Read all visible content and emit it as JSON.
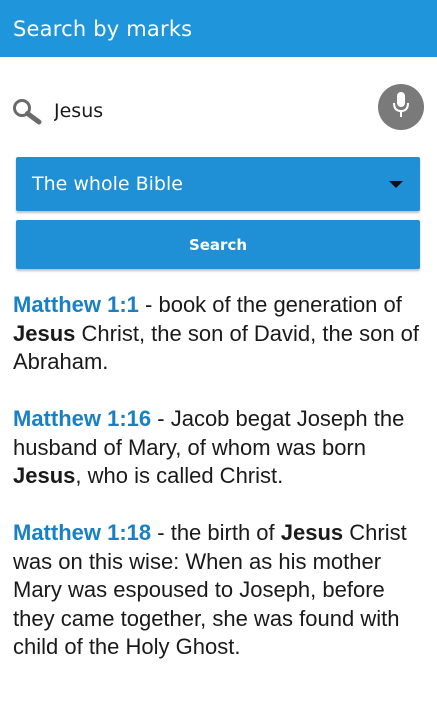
{
  "appbar": {
    "title": "Search by marks"
  },
  "search": {
    "query": "Jesus",
    "icon": "search-icon",
    "mic_icon": "microphone-icon"
  },
  "scope": {
    "selected": "The whole Bible"
  },
  "search_button": {
    "label": "Search"
  },
  "colors": {
    "accent": "#1f95dc",
    "reference": "#1a80c4",
    "mic_bg": "#7a7a7a"
  },
  "results": [
    {
      "reference": "Matthew 1:1",
      "before": " - book of the generation of ",
      "highlight": "Jesus",
      "after": " Christ, the son of David, the son of Abraham."
    },
    {
      "reference": "Matthew 1:16",
      "before": " - Jacob begat Joseph the husband of Mary, of whom was born ",
      "highlight": "Jesus",
      "after": ", who is called Christ."
    },
    {
      "reference": "Matthew 1:18",
      "before": " - the birth of ",
      "highlight": "Jesus",
      "after": " Christ was on this wise: When as his mother Mary was espoused to Joseph, before they came together, she was found with child of the Holy Ghost."
    }
  ]
}
